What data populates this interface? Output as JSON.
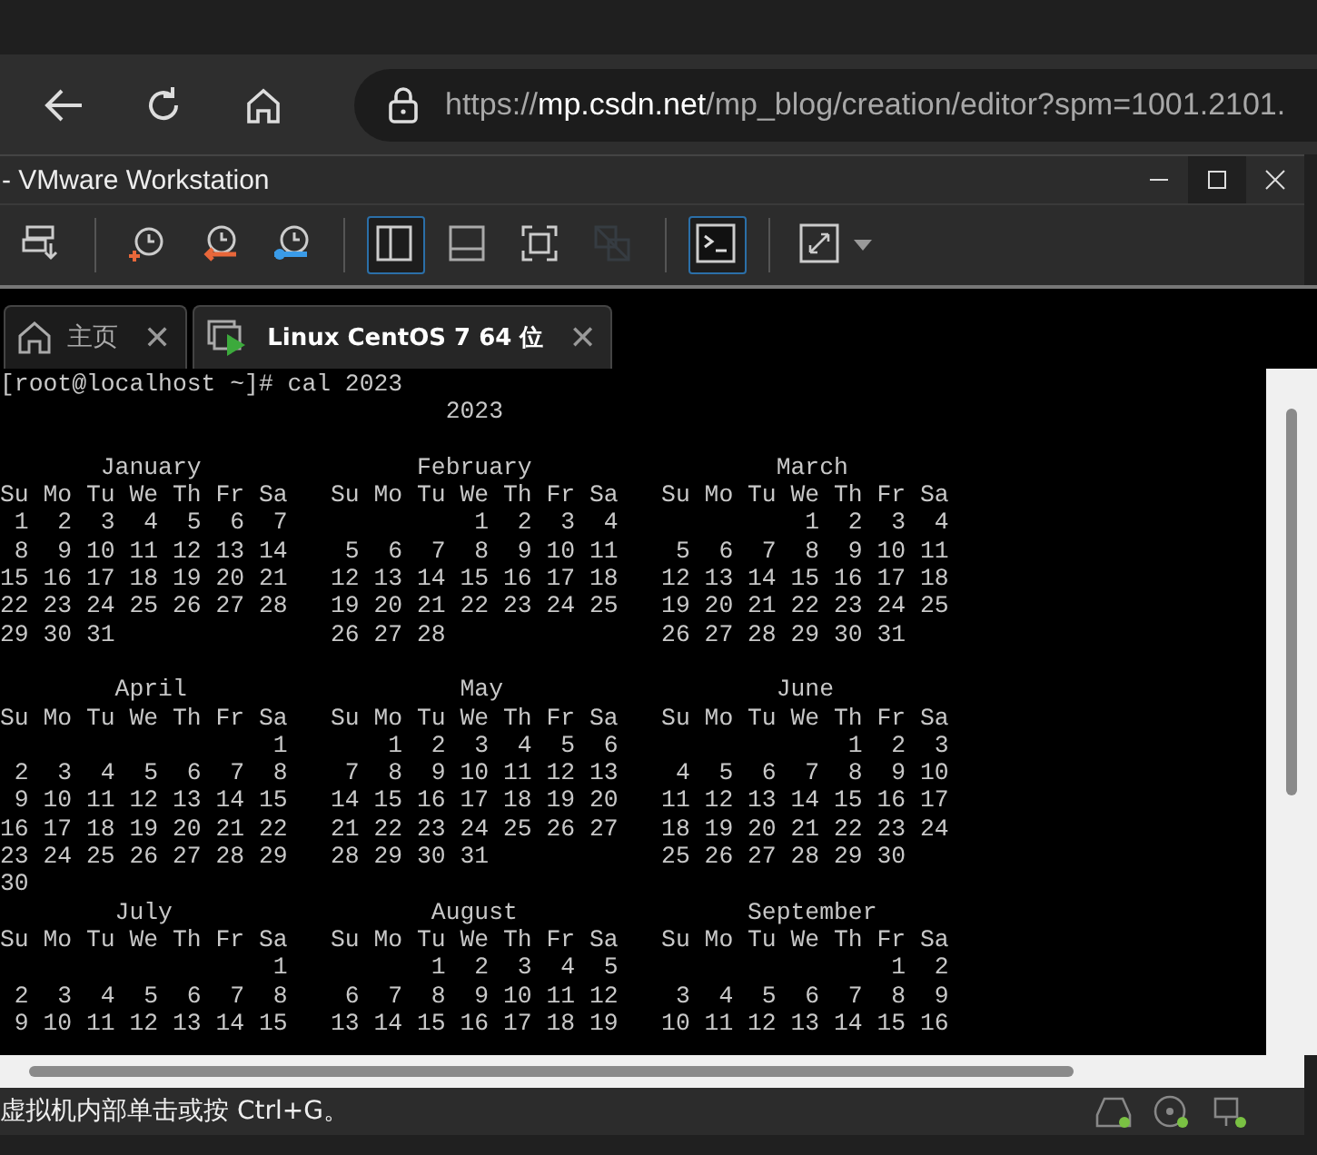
{
  "browser": {
    "url_scheme": "https://",
    "url_host": "mp.csdn.net",
    "url_path": "/mp_blog/creation/editor?spm=1001.2101."
  },
  "window": {
    "title": "- VMware Workstation"
  },
  "toolbar": [
    {
      "kind": "send-keys",
      "selected": false
    },
    {
      "kind": "sep"
    },
    {
      "kind": "snapshot-take",
      "selected": false
    },
    {
      "kind": "snapshot-revert",
      "selected": false
    },
    {
      "kind": "snapshot-manage",
      "selected": false
    },
    {
      "kind": "sep"
    },
    {
      "kind": "view-sidebar",
      "selected": true
    },
    {
      "kind": "view-thumbs",
      "selected": false
    },
    {
      "kind": "fullscreen",
      "selected": false
    },
    {
      "kind": "unity",
      "selected": false,
      "disabled": true
    },
    {
      "kind": "sep"
    },
    {
      "kind": "console",
      "selected": true
    },
    {
      "kind": "sep"
    },
    {
      "kind": "stretch",
      "selected": false
    }
  ],
  "tabs": [
    {
      "kind": "home",
      "label": "主页",
      "close": "✕",
      "selected": false
    },
    {
      "kind": "vm",
      "label": "Linux  CentOS 7 64 位",
      "close": "✕",
      "selected": true
    }
  ],
  "terminal": {
    "prompt": "[root@localhost ~]# cal 2023",
    "output": [
      "                               2023\n",
      "       January               February                 March",
      "Su Mo Tu We Th Fr Sa   Su Mo Tu We Th Fr Sa   Su Mo Tu We Th Fr Sa",
      " 1  2  3  4  5  6  7             1  2  3  4             1  2  3  4",
      " 8  9 10 11 12 13 14    5  6  7  8  9 10 11    5  6  7  8  9 10 11",
      "15 16 17 18 19 20 21   12 13 14 15 16 17 18   12 13 14 15 16 17 18",
      "22 23 24 25 26 27 28   19 20 21 22 23 24 25   19 20 21 22 23 24 25",
      "29 30 31               26 27 28               26 27 28 29 30 31\n",
      "        April                   May                   June",
      "Su Mo Tu We Th Fr Sa   Su Mo Tu We Th Fr Sa   Su Mo Tu We Th Fr Sa",
      "                   1       1  2  3  4  5  6                1  2  3",
      " 2  3  4  5  6  7  8    7  8  9 10 11 12 13    4  5  6  7  8  9 10",
      " 9 10 11 12 13 14 15   14 15 16 17 18 19 20   11 12 13 14 15 16 17",
      "16 17 18 19 20 21 22   21 22 23 24 25 26 27   18 19 20 21 22 23 24",
      "23 24 25 26 27 28 29   28 29 30 31            25 26 27 28 29 30",
      "30",
      "        July                  August                September",
      "Su Mo Tu We Th Fr Sa   Su Mo Tu We Th Fr Sa   Su Mo Tu We Th Fr Sa",
      "                   1          1  2  3  4  5                   1  2",
      " 2  3  4  5  6  7  8    6  7  8  9 10 11 12    3  4  5  6  7  8  9",
      " 9 10 11 12 13 14 15   13 14 15 16 17 18 19   10 11 12 13 14 15 16"
    ]
  },
  "status_bar": {
    "text": "虚拟机内部单击或按 Ctrl+G。"
  }
}
